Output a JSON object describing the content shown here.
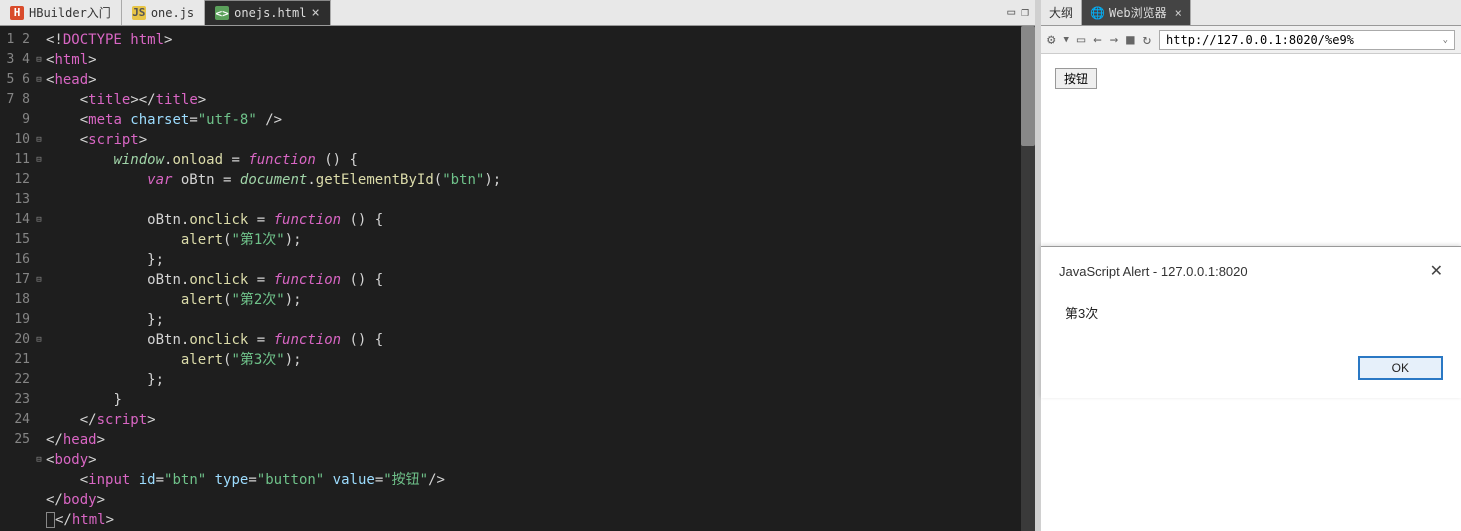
{
  "editor": {
    "tabs": [
      {
        "label": "HBuilder入门",
        "icon": "H",
        "iconClass": "icon-h",
        "active": false,
        "closable": false
      },
      {
        "label": "one.js",
        "icon": "JS",
        "iconClass": "icon-js",
        "active": false,
        "closable": false
      },
      {
        "label": "onejs.html",
        "icon": "<>",
        "iconClass": "icon-html",
        "active": true,
        "closable": true
      }
    ],
    "lineCount": 25,
    "foldMarks": {
      "2": "⊟",
      "3": "⊟",
      "6": "⊟",
      "7": "⊟",
      "10": "⊟",
      "13": "⊟",
      "16": "⊟",
      "22": "⊟"
    },
    "code": {
      "l1": {
        "p": [
          "<!",
          "DOCTYPE html",
          ">"
        ]
      },
      "l2": {
        "p": [
          "<",
          "html",
          ">"
        ]
      },
      "l3": {
        "p": [
          "<",
          "head",
          ">"
        ]
      },
      "l4": {
        "indent": "    ",
        "p": [
          "<",
          "title",
          "></",
          "title",
          ">"
        ]
      },
      "l5": {
        "indent": "    ",
        "p": [
          "<",
          "meta",
          " charset",
          "=",
          "\"utf-8\"",
          " />"
        ]
      },
      "l6": {
        "indent": "    ",
        "p": [
          "<",
          "script",
          ">"
        ]
      },
      "l7": {
        "indent": "        ",
        "p": [
          "window",
          ".",
          "onload",
          " = ",
          "function",
          " () {"
        ]
      },
      "l8": {
        "indent": "            ",
        "p": [
          "var",
          " oBtn = ",
          "document",
          ".",
          "getElementById",
          "(",
          "\"btn\"",
          ");"
        ]
      },
      "l9": {
        "indent": "",
        "p": [
          ""
        ]
      },
      "l10": {
        "indent": "            ",
        "p": [
          "oBtn.",
          "onclick",
          " = ",
          "function",
          " () {"
        ]
      },
      "l11": {
        "indent": "                ",
        "p": [
          "alert",
          "(",
          "\"第1次\"",
          ");"
        ]
      },
      "l12": {
        "indent": "            ",
        "p": [
          "};"
        ]
      },
      "l13": {
        "indent": "            ",
        "p": [
          "oBtn.",
          "onclick",
          " = ",
          "function",
          " () {"
        ]
      },
      "l14": {
        "indent": "                ",
        "p": [
          "alert",
          "(",
          "\"第2次\"",
          ");"
        ]
      },
      "l15": {
        "indent": "            ",
        "p": [
          "};"
        ]
      },
      "l16": {
        "indent": "            ",
        "p": [
          "oBtn.",
          "onclick",
          " = ",
          "function",
          " () {"
        ]
      },
      "l17": {
        "indent": "                ",
        "p": [
          "alert",
          "(",
          "\"第3次\"",
          ");"
        ]
      },
      "l18": {
        "indent": "            ",
        "p": [
          "};"
        ]
      },
      "l19": {
        "indent": "        ",
        "p": [
          "}"
        ]
      },
      "l20": {
        "indent": "    ",
        "p": [
          "</",
          "script",
          ">"
        ]
      },
      "l21": {
        "p": [
          "</",
          "head",
          ">"
        ]
      },
      "l22": {
        "p": [
          "<",
          "body",
          ">"
        ]
      },
      "l23": {
        "indent": "    ",
        "p": [
          "<",
          "input",
          " id",
          "=",
          "\"btn\"",
          " type",
          "=",
          "\"button\"",
          " value",
          "=",
          "\"按钮\"",
          "/>"
        ]
      },
      "l24": {
        "p": [
          "</",
          "body",
          ">"
        ]
      },
      "l25": {
        "p": [
          "</",
          "html",
          ">"
        ]
      }
    }
  },
  "side": {
    "tabs": {
      "outline": "大纲",
      "browser": "Web浏览器"
    },
    "toolbar": {
      "url": "http://127.0.0.1:8020/%e9%"
    },
    "page": {
      "buttonLabel": "按钮"
    },
    "alert": {
      "title": "JavaScript Alert - 127.0.0.1:8020",
      "message": "第3次",
      "ok": "OK"
    }
  }
}
